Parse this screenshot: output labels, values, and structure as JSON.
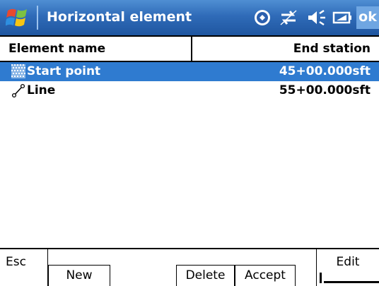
{
  "window": {
    "title": "Horizontal element",
    "ok_label": "ok"
  },
  "status_icons": [
    "sync-icon",
    "connectivity-icon",
    "speaker-icon",
    "battery-icon"
  ],
  "columns": {
    "name_header": "Element name",
    "station_header": "End station"
  },
  "rows": [
    {
      "icon": "start-point-icon",
      "name": "Start point",
      "station": "45+00.000sft",
      "selected": true
    },
    {
      "icon": "line-icon",
      "name": "Line",
      "station": "55+00.000sft",
      "selected": false
    }
  ],
  "toolbar": {
    "esc_label": "Esc",
    "new_label": "New",
    "delete_label": "Delete",
    "accept_label": "Accept",
    "edit_label": "Edit"
  },
  "colors": {
    "titlebar": "#2f6bb8",
    "selection": "#2f7bd0",
    "ok_button": "#6fa6e2"
  }
}
